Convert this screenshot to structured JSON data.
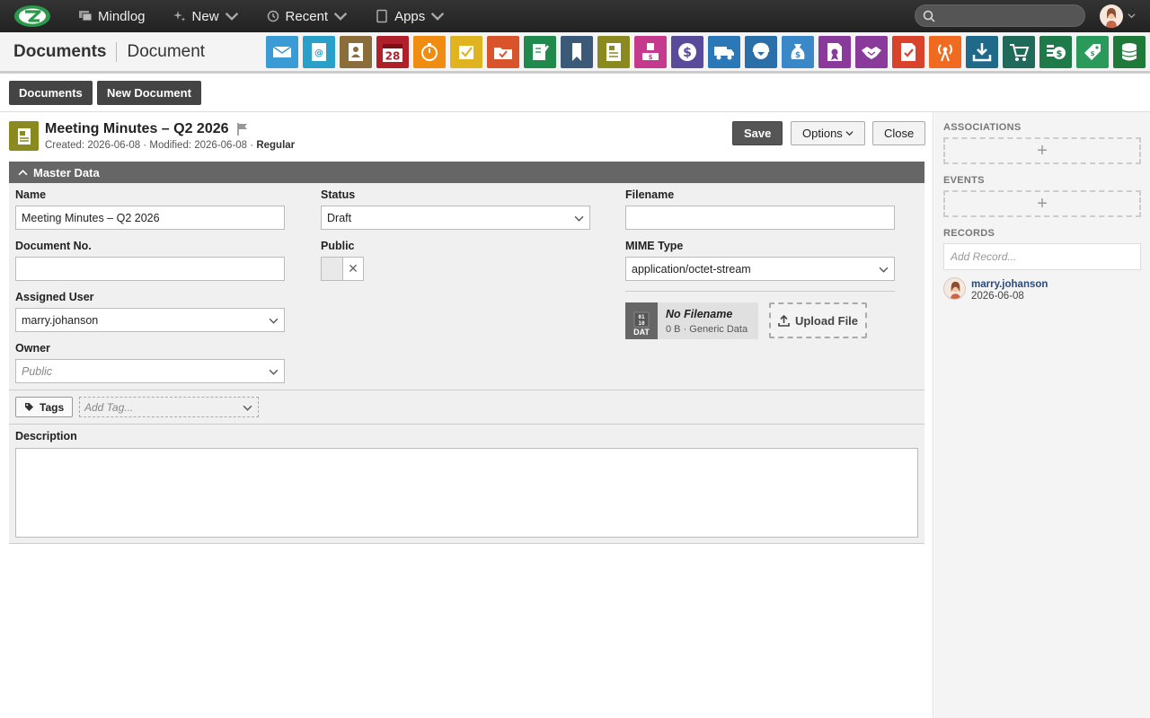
{
  "topbar": {
    "brand": "Mindlog",
    "new_label": "New",
    "recent_label": "Recent",
    "apps_label": "Apps",
    "search_placeholder": ""
  },
  "appbar": {
    "module": "Documents",
    "view": "Document",
    "app_icons": [
      {
        "name": "mail-icon",
        "color": "#3a9bd5"
      },
      {
        "name": "email-account-icon",
        "color": "#2aa0c8"
      },
      {
        "name": "contacts-icon",
        "color": "#8a6d3b"
      },
      {
        "name": "calendar-icon",
        "color": "#b0202a",
        "text": "28"
      },
      {
        "name": "timer-icon",
        "color": "#f08c10"
      },
      {
        "name": "tasks-icon",
        "color": "#e0b420"
      },
      {
        "name": "projects-icon",
        "color": "#d9532b"
      },
      {
        "name": "notes-icon",
        "color": "#1f8a4c"
      },
      {
        "name": "bookmark-icon",
        "color": "#3a5a78"
      },
      {
        "name": "documents-icon",
        "color": "#8a8a1e"
      },
      {
        "name": "contracts-icon",
        "color": "#c53a8c"
      },
      {
        "name": "accounting-icon",
        "color": "#5a4a9a"
      },
      {
        "name": "delivery-icon",
        "color": "#2a78b8"
      },
      {
        "name": "support-icon",
        "color": "#2a6fa8"
      },
      {
        "name": "money-bag-icon",
        "color": "#3a88c8"
      },
      {
        "name": "certificate-icon",
        "color": "#8a3a9a"
      },
      {
        "name": "handshake-icon",
        "color": "#8a3a9a"
      },
      {
        "name": "pdf-icon",
        "color": "#d9432b"
      },
      {
        "name": "broadcast-icon",
        "color": "#f06a20"
      },
      {
        "name": "download-icon",
        "color": "#1f6a8a"
      },
      {
        "name": "cart-icon",
        "color": "#1f6a5a"
      },
      {
        "name": "cash-icon",
        "color": "#1f7a4a"
      },
      {
        "name": "price-tag-icon",
        "color": "#2a9a5a"
      },
      {
        "name": "database-icon",
        "color": "#1f7a3a"
      }
    ]
  },
  "tabs": {
    "documents": "Documents",
    "new_document": "New Document"
  },
  "document": {
    "title": "Meeting Minutes – Q2 2026",
    "created_label": "Created:",
    "created": "2026-06-08",
    "modified_label": "· Modified:",
    "modified": "2026-06-08",
    "type_sep": "·",
    "type": "Regular",
    "save": "Save",
    "options": "Options",
    "close": "Close"
  },
  "master_data": {
    "heading": "Master Data",
    "name_label": "Name",
    "name_value": "Meeting Minutes – Q2 2026",
    "docno_label": "Document No.",
    "docno_value": "",
    "assigned_label": "Assigned User",
    "assigned_value": "marry.johanson",
    "owner_label": "Owner",
    "owner_value": "Public",
    "status_label": "Status",
    "status_value": "Draft",
    "public_label": "Public",
    "filename_label": "Filename",
    "filename_value": "",
    "mime_label": "MIME Type",
    "mime_value": "application/octet-stream"
  },
  "file": {
    "badge_top": "01\n10",
    "badge": "DAT",
    "name": "No Filename",
    "info": "0 B · Generic Data",
    "upload": "Upload File"
  },
  "tags": {
    "button": "Tags",
    "placeholder": "Add Tag..."
  },
  "description": {
    "label": "Description",
    "value": ""
  },
  "sidebar": {
    "associations": "ASSOCIATIONS",
    "events": "EVENTS",
    "records": "RECORDS",
    "add_record_placeholder": "Add Record...",
    "record_user": "marry.johanson",
    "record_date": "2026-06-08"
  }
}
